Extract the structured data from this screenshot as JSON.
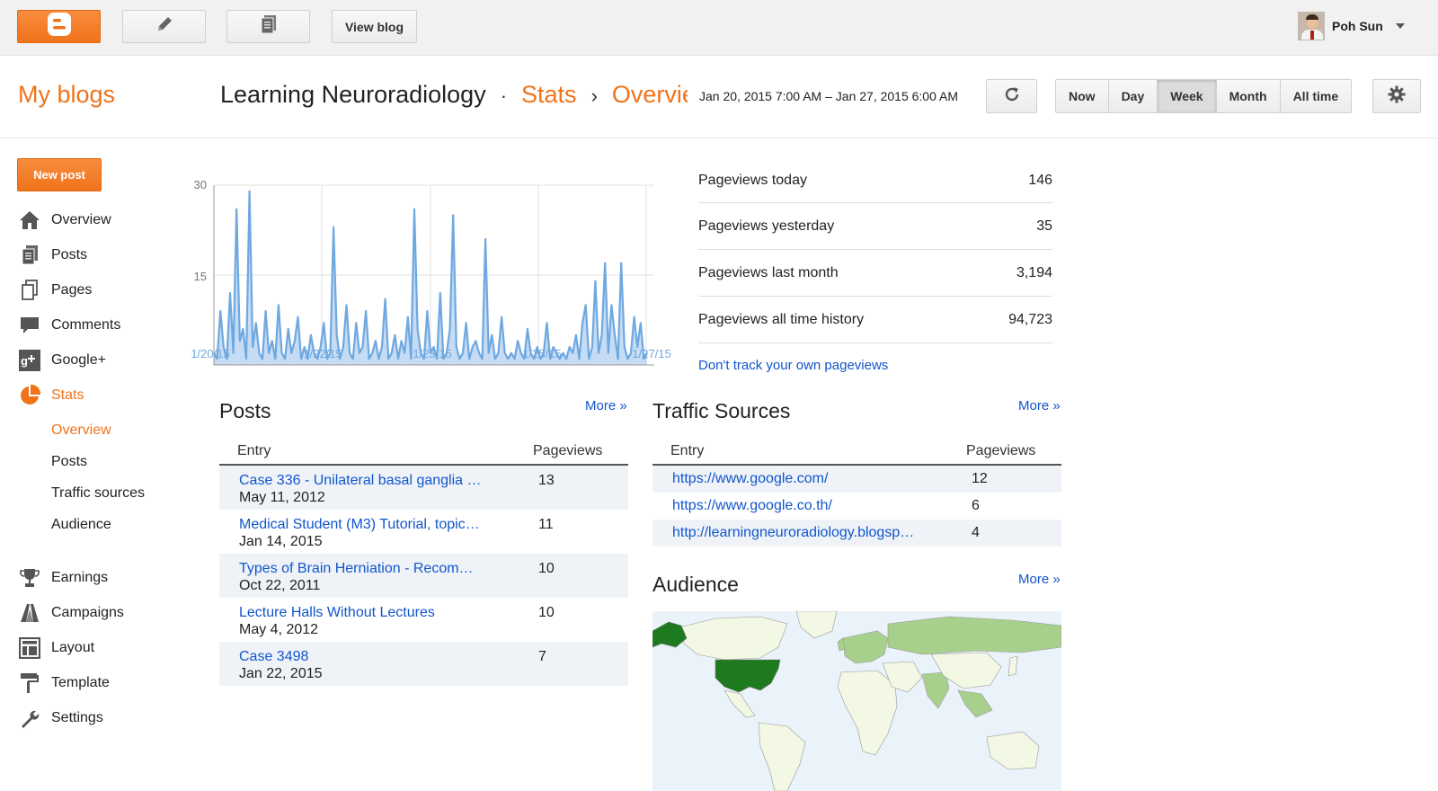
{
  "topbar": {
    "view_blog_label": "View blog",
    "user_name": "Poh Sun",
    "icons": [
      "blogger-icon",
      "pencil-icon",
      "document-icon",
      "chevron-down-icon"
    ]
  },
  "header": {
    "my_blogs": "My blogs",
    "blog_name": "Learning Neuroradiology",
    "sep1": "·",
    "crumb_stats": "Stats",
    "sep2": "›",
    "crumb_overview": "Overview",
    "date_range": "Jan 20, 2015 7:00 AM – Jan 27, 2015 6:00 AM",
    "ranges": [
      "Now",
      "Day",
      "Week",
      "Month",
      "All time"
    ],
    "active_range": "Week"
  },
  "sidebar": {
    "new_post": "New post",
    "items": [
      {
        "label": "Overview",
        "icon": "home-icon"
      },
      {
        "label": "Posts",
        "icon": "posts-icon"
      },
      {
        "label": "Pages",
        "icon": "pages-icon"
      },
      {
        "label": "Comments",
        "icon": "comment-icon"
      },
      {
        "label": "Google+",
        "icon": "google-plus-icon"
      },
      {
        "label": "Stats",
        "icon": "pie-chart-icon"
      },
      {
        "label": "Earnings",
        "icon": "trophy-icon"
      },
      {
        "label": "Campaigns",
        "icon": "campaign-icon"
      },
      {
        "label": "Layout",
        "icon": "layout-icon"
      },
      {
        "label": "Template",
        "icon": "paint-roller-icon"
      },
      {
        "label": "Settings",
        "icon": "wrench-icon"
      }
    ],
    "stats_sub": [
      "Overview",
      "Posts",
      "Traffic sources",
      "Audience"
    ]
  },
  "chart_data": {
    "type": "area",
    "ylim": [
      0,
      30
    ],
    "y_ticks": [
      "30",
      "15"
    ],
    "x_ticks": [
      "1/20/15",
      "1/22/15",
      "1/23/15",
      "1/25/15",
      "1/27/15"
    ],
    "color": "#6fa8e0",
    "values": [
      2,
      1,
      9,
      3,
      1,
      12,
      2,
      26,
      4,
      6,
      1,
      29,
      3,
      7,
      2,
      1,
      9,
      2,
      4,
      1,
      10,
      2,
      1,
      6,
      2,
      4,
      8,
      1,
      3,
      1,
      5,
      2,
      1,
      3,
      7,
      1,
      2,
      23,
      5,
      1,
      3,
      10,
      2,
      1,
      7,
      2,
      3,
      9,
      1,
      2,
      4,
      1,
      3,
      11,
      1,
      2,
      5,
      1,
      4,
      2,
      8,
      1,
      26,
      6,
      2,
      1,
      9,
      2,
      3,
      1,
      12,
      1,
      2,
      6,
      25,
      3,
      1,
      2,
      7,
      1,
      3,
      4,
      2,
      1,
      21,
      2,
      5,
      1,
      2,
      8,
      2,
      1,
      2,
      1,
      4,
      2,
      1,
      6,
      2,
      1,
      3,
      1,
      2,
      7,
      1,
      3,
      2,
      1,
      2,
      1,
      3,
      2,
      5,
      1,
      7,
      10,
      1,
      3,
      14,
      2,
      5,
      17,
      2,
      10,
      5,
      1,
      17,
      3,
      1,
      2,
      8,
      3,
      7,
      1,
      2
    ]
  },
  "stats": [
    {
      "label": "Pageviews today",
      "value": "146"
    },
    {
      "label": "Pageviews yesterday",
      "value": "35"
    },
    {
      "label": "Pageviews last month",
      "value": "3,194"
    },
    {
      "label": "Pageviews all time history",
      "value": "94,723"
    }
  ],
  "dont_track": "Don't track your own pageviews",
  "posts": {
    "title": "Posts",
    "more": "More »",
    "col_entry": "Entry",
    "col_pageviews": "Pageviews",
    "rows": [
      {
        "title": "Case 336 - Unilateral basal ganglia …",
        "date": "May 11, 2012",
        "views": "13"
      },
      {
        "title": "Medical Student (M3) Tutorial, topic…",
        "date": "Jan 14, 2015",
        "views": "11"
      },
      {
        "title": "Types of Brain Herniation - Recom…",
        "date": "Oct 22, 2011",
        "views": "10"
      },
      {
        "title": "Lecture Halls Without Lectures",
        "date": "May 4, 2012",
        "views": "10"
      },
      {
        "title": "Case 3498",
        "date": "Jan 22, 2015",
        "views": "7"
      }
    ]
  },
  "traffic": {
    "title": "Traffic Sources",
    "more": "More »",
    "col_entry": "Entry",
    "col_pageviews": "Pageviews",
    "rows": [
      {
        "url": "https://www.google.com/",
        "views": "12"
      },
      {
        "url": "https://www.google.co.th/",
        "views": "6"
      },
      {
        "url": "http://learningneuroradiology.blogsp…",
        "views": "4"
      }
    ]
  },
  "audience": {
    "title": "Audience",
    "more": "More »"
  },
  "colors": {
    "brand_orange": "#f0731a",
    "link_blue": "#1155cc",
    "map_high": "#1e7a1e",
    "map_mid": "#a8d08d",
    "map_low": "#f3f8e4"
  }
}
